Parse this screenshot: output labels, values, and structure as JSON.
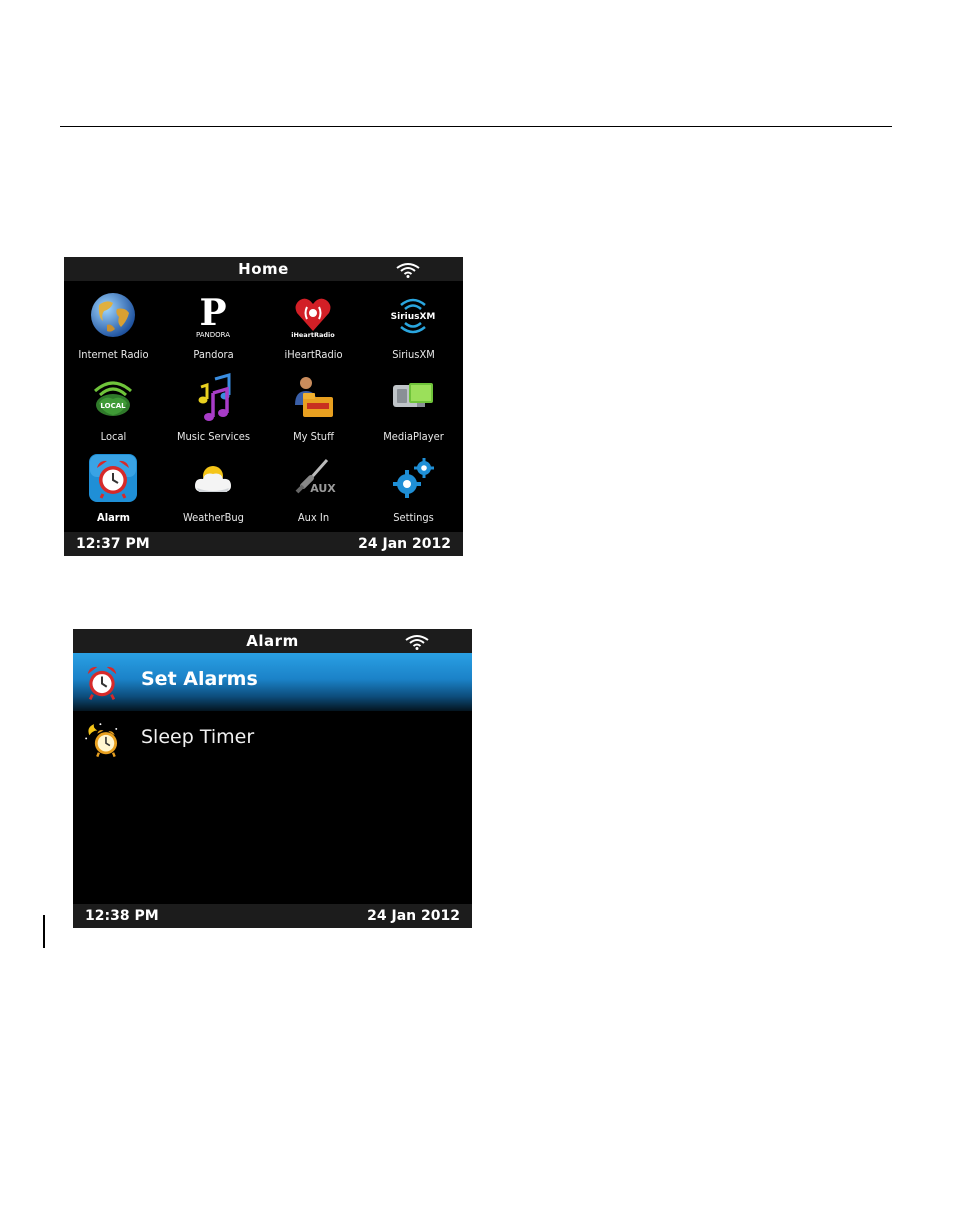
{
  "home": {
    "title": "Home",
    "tiles": [
      {
        "label": "Internet Radio",
        "icon": "globe-icon"
      },
      {
        "label": "Pandora",
        "icon": "pandora-icon",
        "logo_text": "PANDORA"
      },
      {
        "label": "iHeartRadio",
        "icon": "iheartradio-icon",
        "logo_text": "iHeartRadio"
      },
      {
        "label": "SiriusXM",
        "icon": "siriusxm-icon",
        "logo_text": "SiriusXM"
      },
      {
        "label": "Local",
        "icon": "local-icon",
        "logo_text": "LOCAL"
      },
      {
        "label": "Music Services",
        "icon": "music-notes-icon"
      },
      {
        "label": "My Stuff",
        "icon": "my-stuff-icon"
      },
      {
        "label": "MediaPlayer",
        "icon": "media-player-icon"
      },
      {
        "label": "Alarm",
        "icon": "alarm-clock-icon",
        "selected": true
      },
      {
        "label": "WeatherBug",
        "icon": "weather-icon"
      },
      {
        "label": "Aux In",
        "icon": "aux-cable-icon",
        "logo_text": "AUX"
      },
      {
        "label": "Settings",
        "icon": "gears-icon"
      }
    ],
    "status": {
      "time": "12:37 PM",
      "date": "24 Jan 2012"
    }
  },
  "alarm": {
    "title": "Alarm",
    "items": [
      {
        "label": "Set Alarms",
        "icon": "alarm-clock-icon",
        "selected": true
      },
      {
        "label": "Sleep Timer",
        "icon": "sleep-timer-icon"
      }
    ],
    "status": {
      "time": "12:38 PM",
      "date": "24 Jan 2012"
    }
  },
  "colors": {
    "screen_bg": "#000000",
    "bar_bg": "#1c1c1c",
    "highlight": "#1b82c8",
    "alarm_red": "#d62a2a",
    "alarm_tile_blue": "#1f8fd6"
  }
}
